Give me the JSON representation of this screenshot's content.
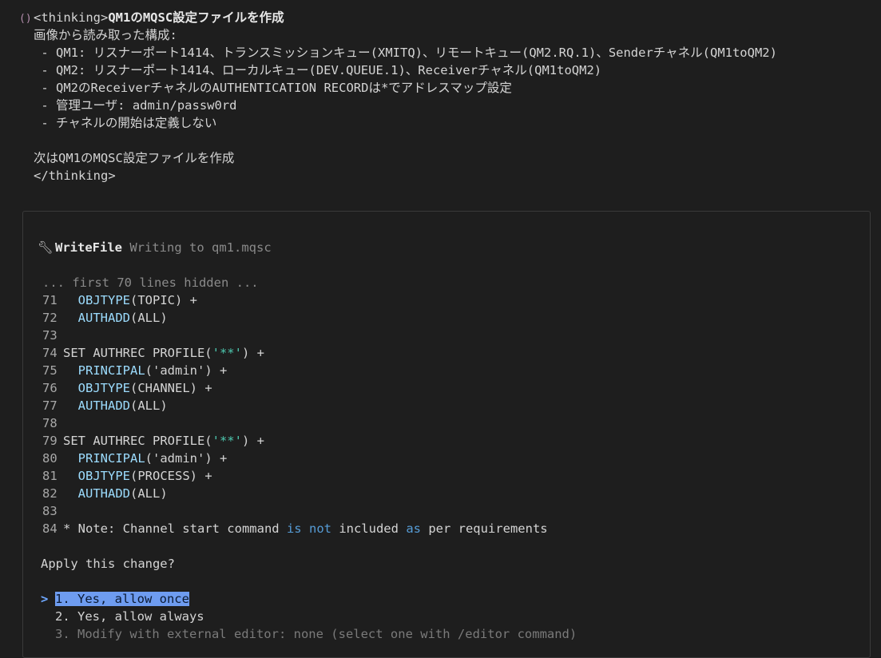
{
  "thinking": {
    "marker": "()",
    "open_tag": "<thinking>",
    "title": "QM1のMQSC設定ファイルを作成",
    "lines": [
      "画像から読み取った構成:",
      " - QM1: リスナーポート1414、トランスミッションキュー(XMITQ)、リモートキュー(QM2.RQ.1)、Senderチャネル(QM1toQM2)",
      " - QM2: リスナーポート1414、ローカルキュー(DEV.QUEUE.1)、Receiverチャネル(QM1toQM2)",
      " - QM2のReceiverチャネルのAUTHENTICATION RECORDは*でアドレスマップ設定",
      " - 管理ユーザ: admin/passw0rd",
      " - チャネルの開始は定義しない",
      "",
      "次はQM1のMQSC設定ファイルを作成",
      "</thinking>"
    ]
  },
  "tool": {
    "icon": "wrench-icon",
    "name": "WriteFile",
    "description": "Writing to qm1.mqsc"
  },
  "code": {
    "hidden_note": "... first 70 lines hidden ...",
    "lines": [
      {
        "no": "71",
        "parts": [
          {
            "t": "  "
          },
          {
            "t": "OBJTYPE",
            "c": "kw"
          },
          {
            "t": "(TOPIC) +"
          }
        ]
      },
      {
        "no": "72",
        "parts": [
          {
            "t": "  "
          },
          {
            "t": "AUTHADD",
            "c": "kw"
          },
          {
            "t": "(ALL)"
          }
        ]
      },
      {
        "no": "73",
        "parts": []
      },
      {
        "no": "74",
        "parts": [
          {
            "t": "SET AUTHREC PROFILE("
          },
          {
            "t": "'**'",
            "c": "str"
          },
          {
            "t": ") +"
          }
        ]
      },
      {
        "no": "75",
        "parts": [
          {
            "t": "  "
          },
          {
            "t": "PRINCIPAL",
            "c": "kw"
          },
          {
            "t": "('admin') +"
          }
        ]
      },
      {
        "no": "76",
        "parts": [
          {
            "t": "  "
          },
          {
            "t": "OBJTYPE",
            "c": "kw"
          },
          {
            "t": "(CHANNEL) +"
          }
        ]
      },
      {
        "no": "77",
        "parts": [
          {
            "t": "  "
          },
          {
            "t": "AUTHADD",
            "c": "kw"
          },
          {
            "t": "(ALL)"
          }
        ]
      },
      {
        "no": "78",
        "parts": []
      },
      {
        "no": "79",
        "parts": [
          {
            "t": "SET AUTHREC PROFILE("
          },
          {
            "t": "'**'",
            "c": "str"
          },
          {
            "t": ") +"
          }
        ]
      },
      {
        "no": "80",
        "parts": [
          {
            "t": "  "
          },
          {
            "t": "PRINCIPAL",
            "c": "kw"
          },
          {
            "t": "('admin') +"
          }
        ]
      },
      {
        "no": "81",
        "parts": [
          {
            "t": "  "
          },
          {
            "t": "OBJTYPE",
            "c": "kw"
          },
          {
            "t": "(PROCESS) +"
          }
        ]
      },
      {
        "no": "82",
        "parts": [
          {
            "t": "  "
          },
          {
            "t": "AUTHADD",
            "c": "kw"
          },
          {
            "t": "(ALL)"
          }
        ]
      },
      {
        "no": "83",
        "parts": []
      },
      {
        "no": "84",
        "parts": [
          {
            "t": "* Note: Channel start command "
          },
          {
            "t": "is",
            "c": "blue"
          },
          {
            "t": " "
          },
          {
            "t": "not",
            "c": "blue"
          },
          {
            "t": " included "
          },
          {
            "t": "as",
            "c": "blue"
          },
          {
            "t": " per requirements"
          }
        ]
      }
    ]
  },
  "prompt": {
    "question": "Apply this change?",
    "selector": ">",
    "options": [
      {
        "label": "1. Yes, allow once",
        "selected": true
      },
      {
        "label": "2. Yes, allow always",
        "selected": false
      },
      {
        "label": "3. Modify with external editor: none (select one with /editor command)",
        "selected": false,
        "dim": true
      }
    ]
  }
}
